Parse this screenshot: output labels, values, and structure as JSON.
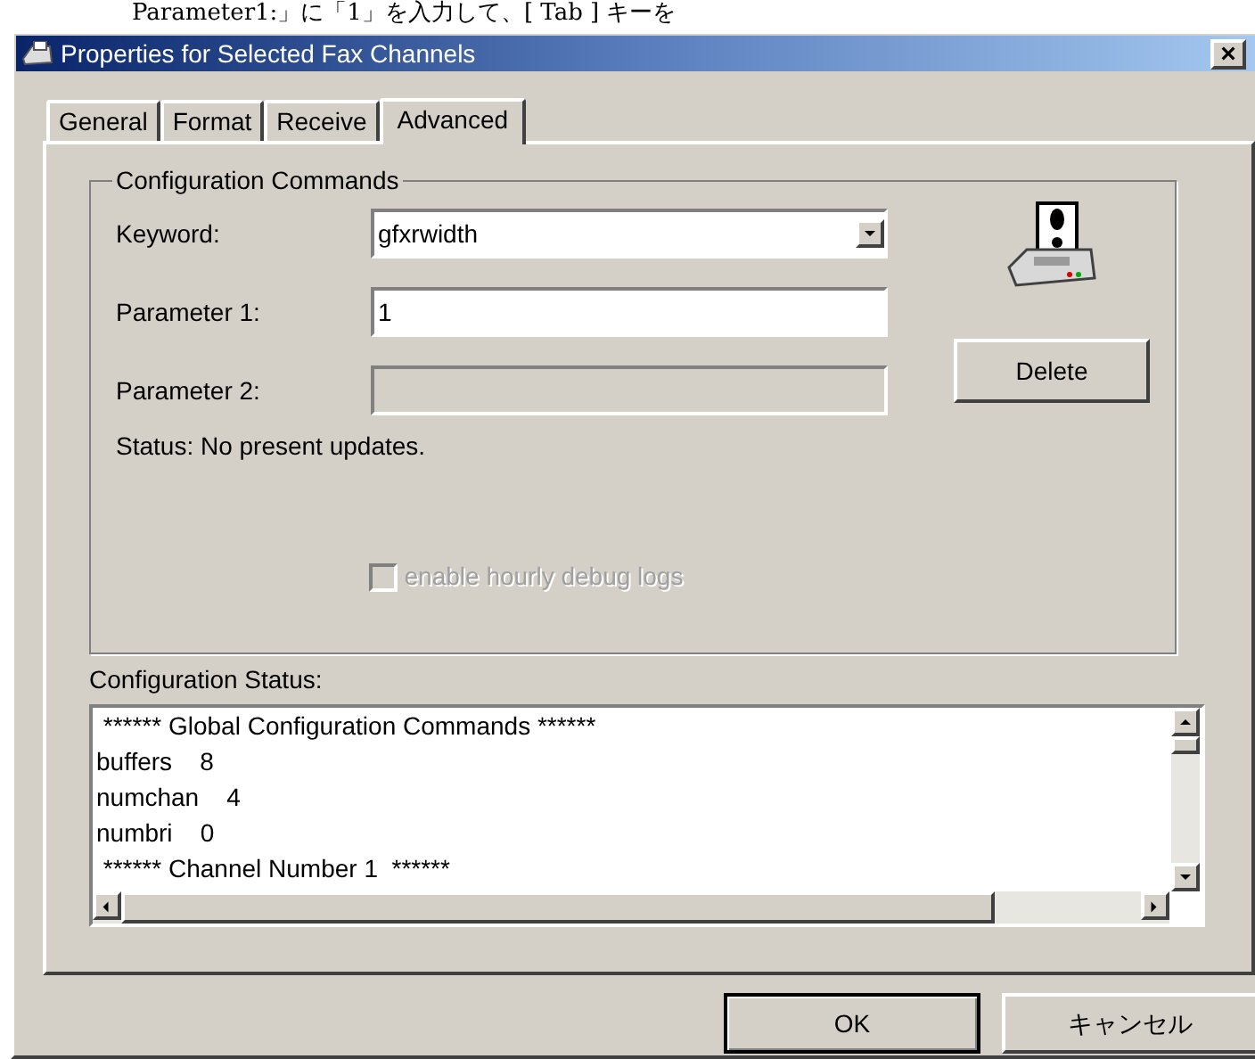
{
  "caption": "Parameter1:」に「1」を入力して、[ Tab ] キーを",
  "window": {
    "title": "Properties for Selected Fax Channels",
    "close": "×"
  },
  "tabs": [
    {
      "label": "General",
      "selected": false
    },
    {
      "label": "Format",
      "selected": false
    },
    {
      "label": "Receive",
      "selected": false
    },
    {
      "label": "Advanced",
      "selected": true
    }
  ],
  "group": {
    "title": "Configuration Commands",
    "keyword": {
      "label": "Keyword:",
      "value": "gfxrwidth"
    },
    "parameter_1": {
      "label": "Parameter 1:",
      "value": "1",
      "disabled": false
    },
    "parameter_2": {
      "label": "Parameter 2:",
      "disabled": true
    },
    "delete_button": {
      "label": "Delete"
    },
    "status": "Status: No present updates.",
    "debug_checkbox": {
      "label": "enable hourly debug logs",
      "checked": false,
      "disabled": true
    }
  },
  "configuration_status": {
    "label": "Configuration Status:",
    "lines": [
      " ****** Global Configuration Commands ******",
      "buffers    8",
      "numchan    4",
      "numbri    0",
      " ****** Channel Number 1  ******"
    ]
  },
  "buttons": [
    {
      "label": "OK",
      "default": true
    },
    {
      "label": "キャンセル",
      "default": false
    }
  ]
}
